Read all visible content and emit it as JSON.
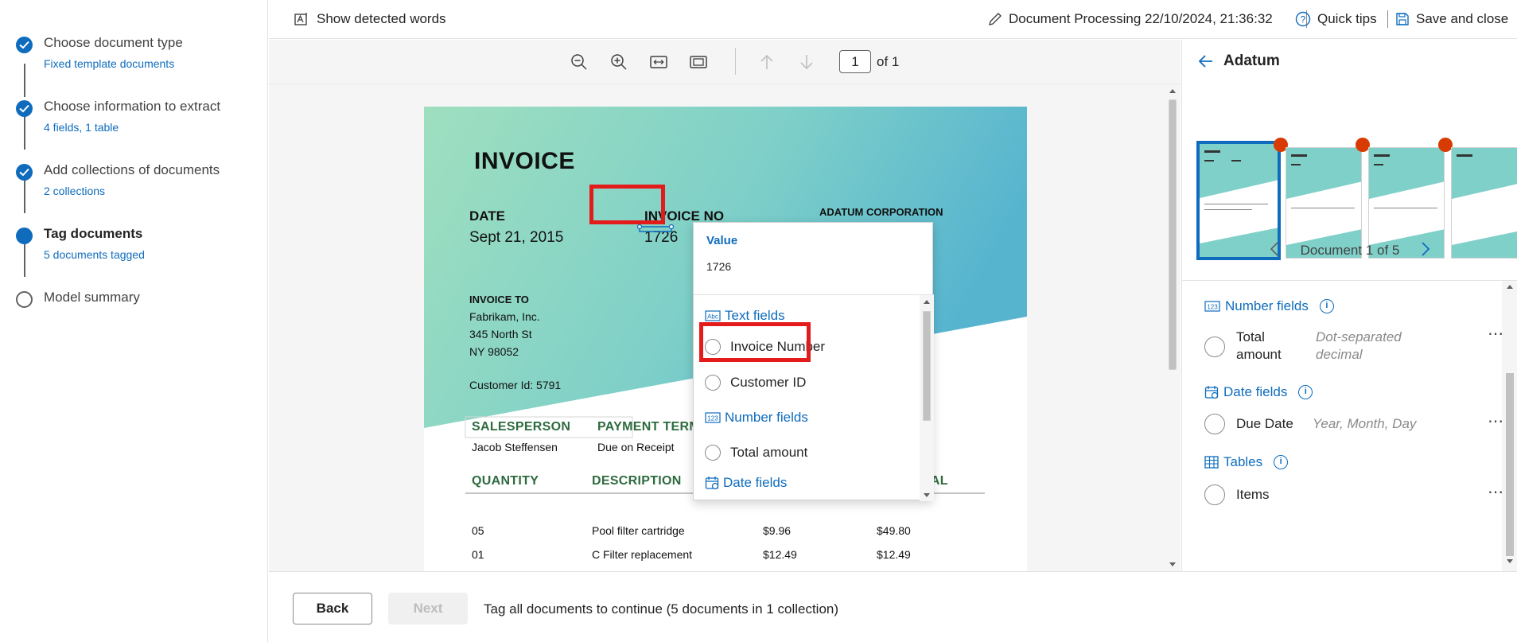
{
  "stepper": {
    "steps": [
      {
        "title": "Choose document type",
        "sub": "Fixed template documents",
        "state": "done"
      },
      {
        "title": "Choose information to extract",
        "sub": "4 fields, 1 table",
        "state": "done"
      },
      {
        "title": "Add collections of documents",
        "sub": "2 collections",
        "state": "done"
      },
      {
        "title": "Tag documents",
        "sub": "5 documents tagged",
        "state": "current"
      },
      {
        "title": "Model summary",
        "sub": "",
        "state": "pending"
      }
    ]
  },
  "topbar": {
    "show_words": "Show detected words",
    "doc_title": "Document Processing 22/10/2024, 21:36:32",
    "quick_tips": "Quick tips",
    "save_close": "Save and close"
  },
  "viewer": {
    "page_current": "1",
    "page_of": "of 1"
  },
  "invoice": {
    "title": "INVOICE",
    "date_label": "DATE",
    "date_value": "Sept 21, 2015",
    "invno_label": "INVOICE NO",
    "invno_value": "1726",
    "company": "ADATUM CORPORATION",
    "invoice_to_label": "INVOICE TO",
    "to_line1": "Fabrikam, Inc.",
    "to_line2": "345 North St",
    "to_line3": "NY 98052",
    "customer_id": "Customer Id: 5791",
    "salesperson_label": "SALESPERSON",
    "salesperson_value": "Jacob Steffensen",
    "payment_label": "PAYMENT TERM",
    "payment_value": "Due on Receipt",
    "col_quantity": "QUANTITY",
    "col_description": "DESCRIPTION",
    "col_total": "TAL",
    "rows": [
      {
        "qty": "05",
        "desc": "Pool filter cartridge",
        "price": "$9.96",
        "total": "$49.80"
      },
      {
        "qty": "01",
        "desc": "C Filter replacement",
        "price": "$12.49",
        "total": "$12.49"
      }
    ]
  },
  "popup": {
    "value_label": "Value",
    "value_text": "1726",
    "groups": {
      "text": "Text fields",
      "number": "Number fields",
      "date": "Date fields"
    },
    "options": {
      "invoice_number": "Invoice Number",
      "customer_id": "Customer ID",
      "total_amount": "Total amount"
    }
  },
  "rpanel": {
    "title": "Adatum",
    "doc_nav": "Document 1 of 5",
    "groups": {
      "number": "Number fields",
      "date": "Date fields",
      "tables": "Tables"
    },
    "fields": {
      "total_amount_1": "Total",
      "total_amount_2": "amount",
      "total_hint_1": "Dot-separated",
      "total_hint_2": "decimal",
      "due_date": "Due Date",
      "due_hint": "Year, Month, Day",
      "items": "Items",
      "more": "⋯"
    }
  },
  "footer": {
    "back": "Back",
    "next": "Next",
    "message": "Tag all documents to continue (5 documents in 1 collection)"
  },
  "colors": {
    "accent": "#0f6cbd",
    "highlight": "#e31b1b",
    "badge": "#d83b01",
    "invoice_green": "#2e6b3e"
  }
}
